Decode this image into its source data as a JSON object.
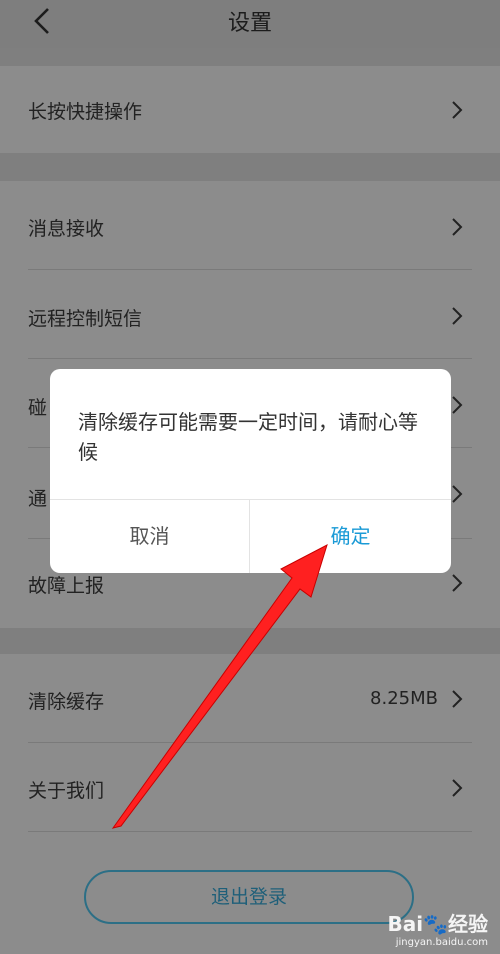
{
  "header": {
    "title": "设置"
  },
  "rows": [
    {
      "label": "长按快捷操作"
    },
    {
      "label": "消息接收"
    },
    {
      "label": "远程控制短信"
    },
    {
      "label": "碰"
    },
    {
      "label": "通"
    },
    {
      "label": "故障上报"
    },
    {
      "label": "清除缓存",
      "value": "8.25MB"
    },
    {
      "label": "关于我们"
    }
  ],
  "logout": {
    "label": "退出登录"
  },
  "dialog": {
    "message": "清除缓存可能需要一定时间，请耐心等候",
    "cancel_label": "取消",
    "confirm_label": "确定"
  },
  "watermark": {
    "main": "Bai🐾经验",
    "sub": "jingyan.baidu.com"
  },
  "colors": {
    "accent": "#1a9ad6",
    "logout": "#2c6f86",
    "arrow": "#ff2020"
  }
}
